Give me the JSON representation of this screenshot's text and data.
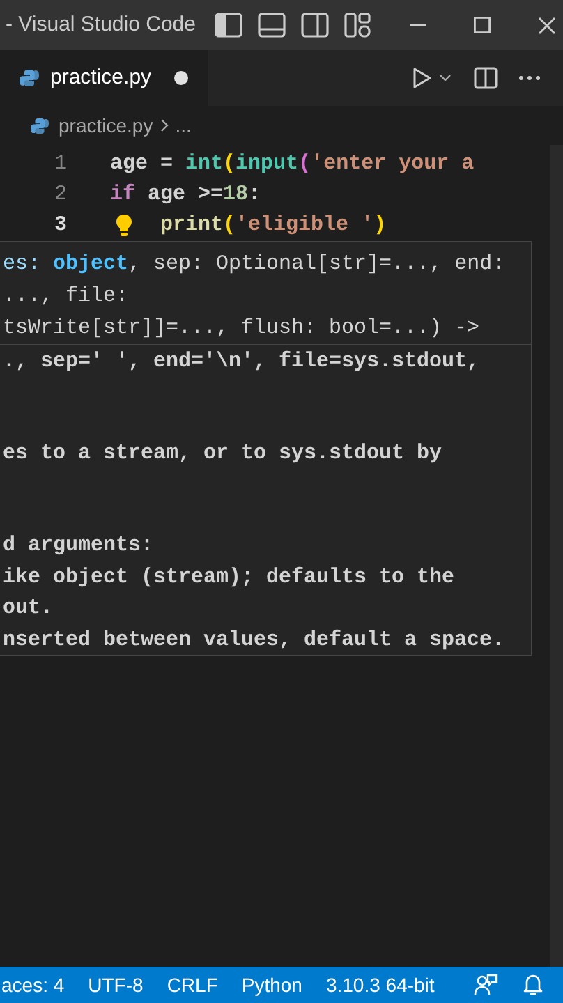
{
  "window": {
    "title": "- Visual Studio Code"
  },
  "tab": {
    "label": "practice.py",
    "modified": true,
    "selected": true
  },
  "breadcrumb": {
    "file": "practice.py",
    "more": "..."
  },
  "code_lines": [
    {
      "number": "1",
      "current": false,
      "tokens": [
        {
          "text": "age = ",
          "kind": "plain"
        },
        {
          "text": "int",
          "kind": "type"
        },
        {
          "text": "(",
          "kind": "bracket1"
        },
        {
          "text": "input",
          "kind": "type"
        },
        {
          "text": "(",
          "kind": "bracket2"
        },
        {
          "text": "'enter your a",
          "kind": "string"
        }
      ]
    },
    {
      "number": "2",
      "current": false,
      "tokens": [
        {
          "text": "if",
          "kind": "keyword"
        },
        {
          "text": " age >=",
          "kind": "plain"
        },
        {
          "text": "18",
          "kind": "number"
        },
        {
          "text": ":",
          "kind": "plain"
        }
      ]
    },
    {
      "number": "3",
      "current": true,
      "lightbulb": true,
      "tokens": [
        {
          "text": "print",
          "kind": "function"
        },
        {
          "text": "(",
          "kind": "bracket1"
        },
        {
          "text": "'eligible '",
          "kind": "string"
        },
        {
          "text": ")",
          "kind": "bracket1"
        }
      ]
    }
  ],
  "hover": {
    "signature": [
      [
        {
          "text": "es: ",
          "kind": "param"
        },
        {
          "text": "object",
          "kind": "param_active"
        },
        {
          "text": ", sep: Optional[str]=..., end:",
          "kind": "plain"
        }
      ],
      [
        {
          "text": "..., file:",
          "kind": "plain"
        }
      ],
      [
        {
          "text": "tsWrite[str]]=..., flush: bool=...) ->",
          "kind": "plain"
        }
      ]
    ],
    "code": "., sep=' ', end='\\n', file=sys.stdout,",
    "paragraphs": [
      [
        "es to a stream, or to sys.stdout by"
      ],
      [
        "d arguments:",
        "ike object (stream); defaults to the",
        "out.",
        "nserted between values, default a space."
      ]
    ]
  },
  "status_bar": [
    "aces: 4",
    "UTF-8",
    "CRLF",
    "Python",
    "3.10.3 64-bit"
  ]
}
